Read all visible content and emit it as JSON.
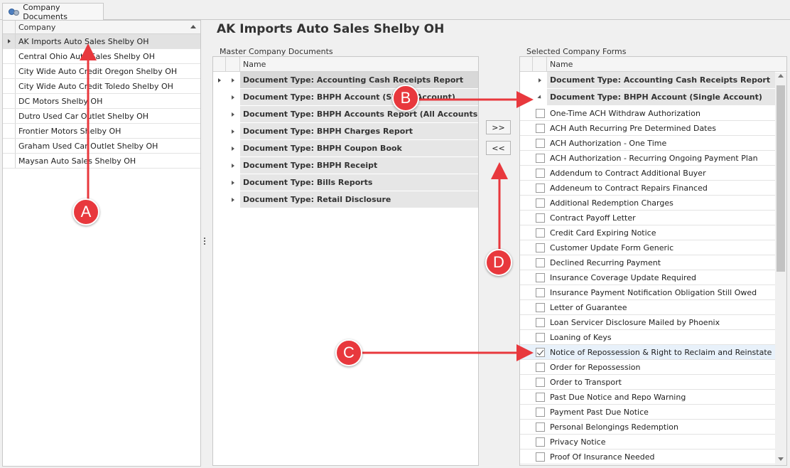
{
  "tab": {
    "label": "Company Documents",
    "icon": "company-documents-icon"
  },
  "company_grid": {
    "header": "Company",
    "rows": [
      "AK Imports Auto Sales  Shelby OH",
      "Central Ohio Auto Sales  Shelby OH",
      "City Wide Auto Credit Oregon Shelby OH",
      "City Wide Auto Credit Toledo Shelby OH",
      "DC Motors  Shelby OH",
      "Dutro Used Car Outlet  Shelby OH",
      "Frontier Motors  Shelby OH",
      "Graham Used Car Outlet  Shelby OH",
      "Maysan Auto Sales  Shelby OH"
    ]
  },
  "page_title": "AK Imports Auto Sales  Shelby OH",
  "master_docs": {
    "label": "Master Company Documents",
    "header": "Name",
    "groups": [
      "Document Type: Accounting Cash Receipts Report",
      "Document Type: BHPH Account (Single Account)",
      "Document Type: BHPH Accounts Report (All Accounts)",
      "Document Type: BHPH Charges Report",
      "Document Type: BHPH Coupon Book",
      "Document Type: BHPH Receipt",
      "Document Type: Bills Reports",
      "Document Type: Retail Disclosure"
    ]
  },
  "buttons": {
    "add": ">>",
    "remove": "<<"
  },
  "selected_forms": {
    "label": "Selected Company Forms",
    "header": "Name",
    "groups": [
      "Document Type: Accounting Cash Receipts Report",
      "Document Type: BHPH Account (Single Account)"
    ],
    "items": [
      "One-Time ACH Withdraw Authorization",
      "ACH Auth Recurring Pre Determined Dates",
      "ACH Authorization - One Time",
      "ACH Authorization - Recurring Ongoing Payment Plan",
      "Addendum to Contract Additional Buyer",
      "Addeneum to Contract Repairs Financed",
      "Additional Redemption Charges",
      "Contract Payoff Letter",
      "Credit Card Expiring Notice",
      "Customer Update Form Generic",
      "Declined Recurring Payment",
      "Insurance Coverage Update Required",
      "Insurance Payment Notification Obligation Still Owed",
      "Letter of Guarantee",
      "Loan Servicer Disclosure Mailed by Phoenix",
      "Loaning of Keys",
      "Notice of Repossession & Right to Reclaim and Reinstate",
      "Order for Repossession",
      "Order to Transport",
      "Past Due Notice and Repo Warning",
      "Payment Past Due Notice",
      "Personal Belongings Redemption",
      "Privacy Notice",
      "Proof Of Insurance Needed"
    ],
    "checked_item": "Notice of Repossession & Right to Reclaim and Reinstate"
  },
  "annotations": {
    "a": "A",
    "b": "B",
    "c": "C",
    "d": "D",
    "color": "#e8383d"
  }
}
